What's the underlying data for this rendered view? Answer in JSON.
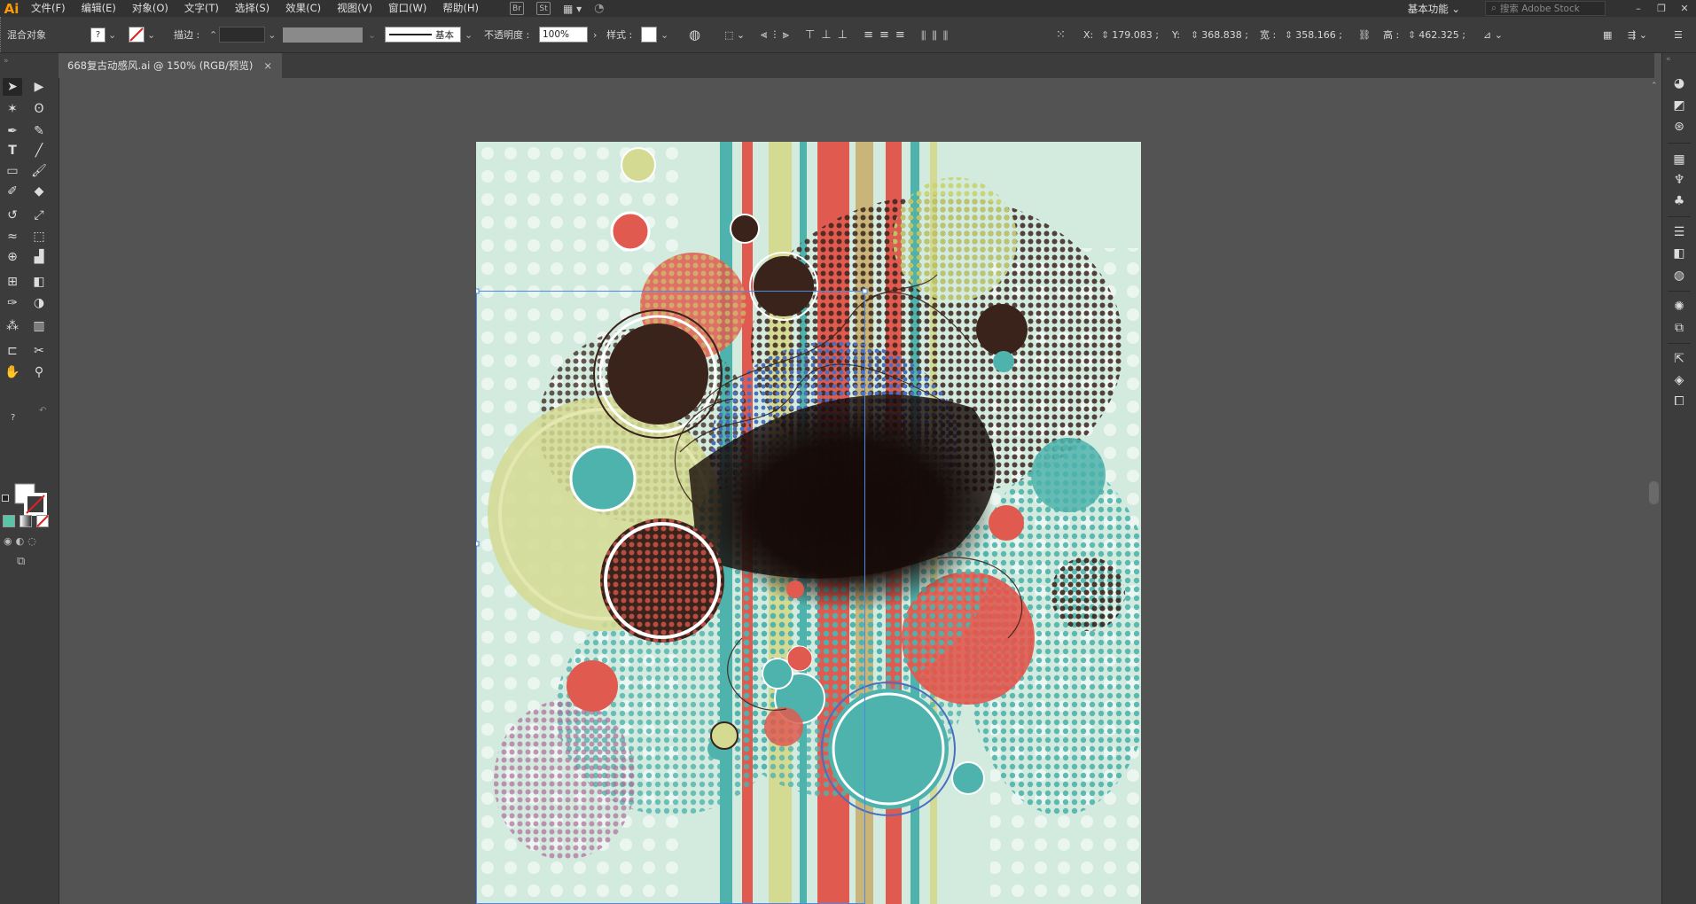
{
  "app": {
    "logo": "Ai"
  },
  "menu": {
    "items": [
      "文件(F)",
      "编辑(E)",
      "对象(O)",
      "文字(T)",
      "选择(S)",
      "效果(C)",
      "视图(V)",
      "窗口(W)",
      "帮助(H)"
    ],
    "icons": [
      "bridge-icon",
      "stock-st-icon",
      "arrange-documents-icon",
      "gpu-performance-icon"
    ],
    "st_label": "St",
    "workspace": "基本功能",
    "search_placeholder": "搜索 Adobe Stock"
  },
  "control": {
    "object_type": "混合对象",
    "stroke_label": "描边 :",
    "brush_label": "基本",
    "opacity_label": "不透明度 :",
    "opacity_value": "100%",
    "style_label": "样式 :",
    "x_label": "X:",
    "x_value": "179.083 ;",
    "y_label": "Y:",
    "y_value": "368.838 ;",
    "w_label": "宽 :",
    "w_value": "358.166 ;",
    "h_label": "高 :",
    "h_value": "462.325 ;"
  },
  "document": {
    "tab_title": "668复古动感风.ai @ 150% (RGB/预览)",
    "close_label": "×"
  },
  "tools": [
    "selection-tool",
    "direct-selection-tool",
    "magic-wand-tool",
    "lasso-tool",
    "pen-tool",
    "curvature-tool",
    "type-tool",
    "line-tool",
    "rectangle-tool",
    "paintbrush-tool",
    "shaper-tool",
    "eraser-tool",
    "rotate-tool",
    "scale-tool",
    "warp-tool",
    "free-transform-tool",
    "shape-builder-tool",
    "perspective-grid-tool",
    "mesh-tool",
    "gradient-tool",
    "eyedropper-tool",
    "blend-tool",
    "symbol-sprayer-tool",
    "column-graph-tool",
    "artboard-tool",
    "slice-tool",
    "hand-tool",
    "zoom-tool"
  ],
  "panels": [
    "color-panel-icon",
    "color-guide-icon",
    "libraries-icon",
    "swatches-icon",
    "brushes-icon",
    "symbols-icon",
    "stroke-icon",
    "gradient-icon",
    "transparency-icon",
    "appearance-icon",
    "graphic-styles-icon",
    "export-icon",
    "layers-icon",
    "artboards-icon"
  ],
  "colors": {
    "bg_mint": "#d3ebdf",
    "teal": "#4fb3ad",
    "coral": "#e05a50",
    "brown": "#3a231b",
    "olive": "#d4da92",
    "blue": "#4a6fc0",
    "selection": "#4d8ae6"
  }
}
